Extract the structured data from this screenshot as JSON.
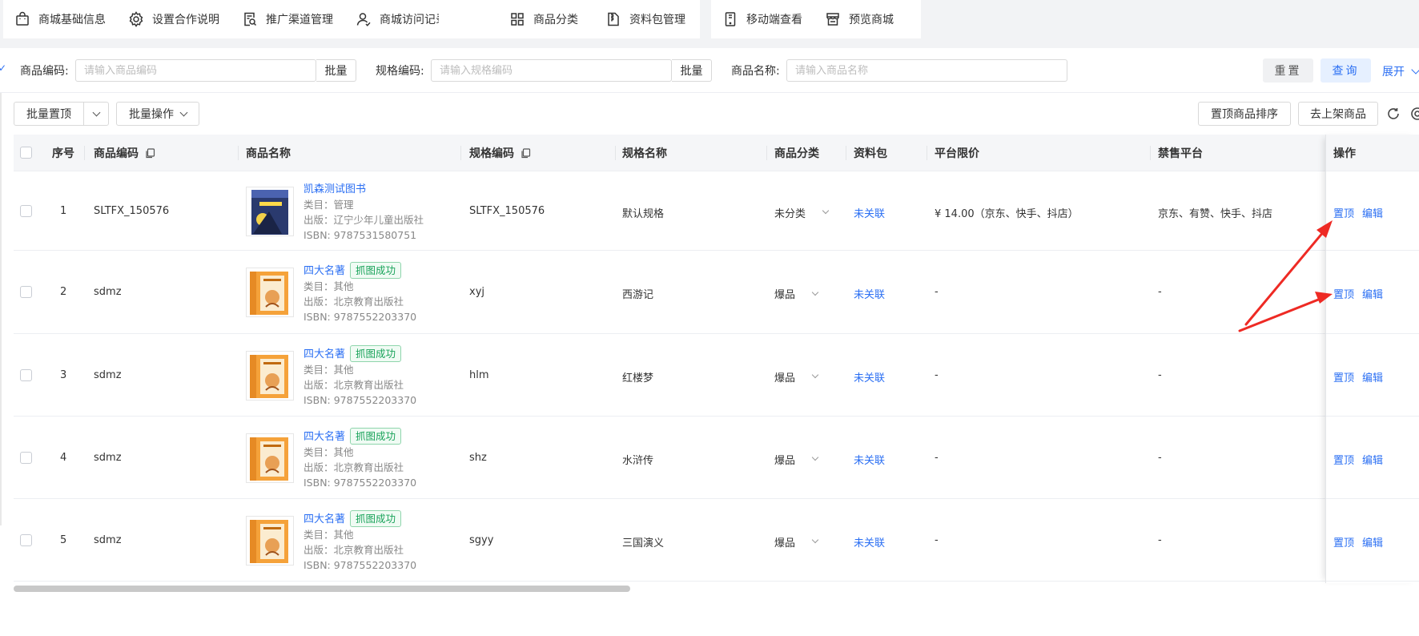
{
  "toolbar": {
    "items": [
      {
        "label": "商城基础信息",
        "icon": "bag-icon"
      },
      {
        "label": "设置合作说明",
        "icon": "gear-icon"
      },
      {
        "label": "推广渠道管理",
        "icon": "document-search-icon"
      },
      {
        "label": "商城访问记录",
        "icon": "user-record-icon"
      },
      {
        "label": "商品分类",
        "icon": "grid-icon"
      },
      {
        "label": "资料包管理",
        "icon": "zip-file-icon"
      },
      {
        "label": "移动端查看",
        "icon": "mobile-icon"
      },
      {
        "label": "预览商城",
        "icon": "store-icon"
      }
    ]
  },
  "search": {
    "code_label": "商品编码:",
    "code_placeholder": "请输入商品编码",
    "batch1": "批量",
    "spec_label": "规格编码:",
    "spec_placeholder": "请输入规格编码",
    "batch2": "批量",
    "name_label": "商品名称:",
    "name_placeholder": "请输入商品名称",
    "reset": "重置",
    "query": "查询",
    "expand": "展开"
  },
  "actions": {
    "batch_top": "批量置顶",
    "batch_ops": "批量操作",
    "sort_top": "置顶商品排序",
    "go_shelf": "去上架商品"
  },
  "table": {
    "headers": {
      "index": "序号",
      "code": "商品编码",
      "name": "商品名称",
      "spec_code": "规格编码",
      "spec_name": "规格名称",
      "category": "商品分类",
      "package": "资料包",
      "price_limit": "平台限价",
      "banned": "禁售平台",
      "ops": "操作"
    },
    "rows": [
      {
        "index": "1",
        "code": "SLTFX_150576",
        "name": "凯森测试图书",
        "tag": "",
        "category_line": "类目：管理",
        "publisher": "出版：辽宁少年儿童出版社",
        "isbn": "ISBN: 9787531580751",
        "spec_code": "SLTFX_150576",
        "spec_name": "默认规格",
        "category": "未分类",
        "package": "未关联",
        "price_limit": "¥ 14.00（京东、快手、抖店）",
        "banned": "京东、有赞、快手、抖店",
        "op_top": "置顶",
        "op_edit": "编辑"
      },
      {
        "index": "2",
        "code": "sdmz",
        "name": "四大名著",
        "tag": "抓图成功",
        "category_line": "类目：其他",
        "publisher": "出版：北京教育出版社",
        "isbn": "ISBN: 9787552203370",
        "spec_code": "xyj",
        "spec_name": "西游记",
        "category": "爆品",
        "package": "未关联",
        "price_limit": "-",
        "banned": "-",
        "op_top": "置顶",
        "op_edit": "编辑"
      },
      {
        "index": "3",
        "code": "sdmz",
        "name": "四大名著",
        "tag": "抓图成功",
        "category_line": "类目：其他",
        "publisher": "出版：北京教育出版社",
        "isbn": "ISBN: 9787552203370",
        "spec_code": "hlm",
        "spec_name": "红楼梦",
        "category": "爆品",
        "package": "未关联",
        "price_limit": "-",
        "banned": "-",
        "op_top": "置顶",
        "op_edit": "编辑"
      },
      {
        "index": "4",
        "code": "sdmz",
        "name": "四大名著",
        "tag": "抓图成功",
        "category_line": "类目：其他",
        "publisher": "出版：北京教育出版社",
        "isbn": "ISBN: 9787552203370",
        "spec_code": "shz",
        "spec_name": "水浒传",
        "category": "爆品",
        "package": "未关联",
        "price_limit": "-",
        "banned": "-",
        "op_top": "置顶",
        "op_edit": "编辑"
      },
      {
        "index": "5",
        "code": "sdmz",
        "name": "四大名著",
        "tag": "抓图成功",
        "category_line": "类目：其他",
        "publisher": "出版：北京教育出版社",
        "isbn": "ISBN: 9787552203370",
        "spec_code": "sgyy",
        "spec_name": "三国演义",
        "category": "爆品",
        "package": "未关联",
        "price_limit": "-",
        "banned": "-",
        "op_top": "置顶",
        "op_edit": "编辑"
      }
    ]
  },
  "colors": {
    "accent": "#2b6ff3",
    "tag_green": "#19a35a",
    "annotation_arrow": "#ee2a24"
  }
}
